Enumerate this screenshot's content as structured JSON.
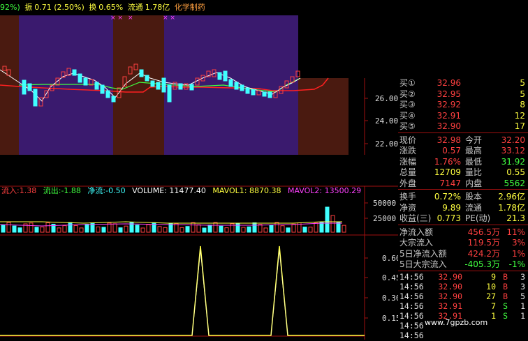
{
  "header": {
    "pct_fragment": "92%)",
    "amplitude_label": "振",
    "amplitude_value": "0.71 (2.50%)",
    "turnover_label": "换",
    "turnover_value": "0.65%",
    "float_label": "流通",
    "float_value": "1.78亿",
    "sector": "化学制药"
  },
  "price_axis": [
    "26.00",
    "24.00",
    "22.00"
  ],
  "volume_header": {
    "inflow_label": "流入:",
    "inflow_value": "1.38",
    "outflow_label": "流出:",
    "outflow_value": "-1.88",
    "net_label": "净流:",
    "net_value": "-0.50",
    "volume_text": "VOLUME: 11477.40",
    "mavol1_text": "MAVOL1: 8870.38",
    "mavol2_text": "MAVOL2: 13500.29"
  },
  "volume_axis": [
    "50000",
    "25000"
  ],
  "indicator_axis": [
    "0.60",
    "0.45",
    "0.30",
    "0.15"
  ],
  "order_book": [
    {
      "label": "买①",
      "price": "32.96",
      "qty": "5"
    },
    {
      "label": "买②",
      "price": "32.95",
      "qty": "5"
    },
    {
      "label": "买③",
      "price": "32.92",
      "qty": "8"
    },
    {
      "label": "买④",
      "price": "32.91",
      "qty": "12"
    },
    {
      "label": "买⑤",
      "price": "32.90",
      "qty": "17"
    }
  ],
  "quote": [
    {
      "l1": "现价",
      "v1": "32.98",
      "l2": "今开",
      "v2": "32.20",
      "c1": "#ff4040",
      "c2": "#ff4040"
    },
    {
      "l1": "涨跌",
      "v1": "0.57",
      "l2": "最高",
      "v2": "33.12",
      "c1": "#ff4040",
      "c2": "#ff4040"
    },
    {
      "l1": "涨幅",
      "v1": "1.76%",
      "l2": "最低",
      "v2": "31.92",
      "c1": "#ff4040",
      "c2": "#40ff40"
    },
    {
      "l1": "总量",
      "v1": "12709",
      "l2": "量比",
      "v2": "0.55",
      "c1": "#ffff40",
      "c2": "#ffff40"
    },
    {
      "l1": "外盘",
      "v1": "7147",
      "l2": "内盘",
      "v2": "5562",
      "c1": "#ff4040",
      "c2": "#40ff40"
    }
  ],
  "stats": [
    {
      "l1": "换手",
      "v1": "0.72%",
      "l2": "股本",
      "v2": "2.96亿"
    },
    {
      "l1": "净资",
      "v1": "9.89",
      "l2": "流通",
      "v2": "1.78亿"
    },
    {
      "l1": "收益(三)",
      "v1": "0.773",
      "l2": "PE(动)",
      "v2": "21.3"
    }
  ],
  "flows": [
    {
      "label": "净流入额",
      "value": "456.5万",
      "pct": "11%",
      "color": "#ff4040"
    },
    {
      "label": "大宗流入",
      "value": "119.5万",
      "pct": "3%",
      "color": "#ff4040"
    },
    {
      "label": "5日净流入额",
      "value": "424.2万",
      "pct": "1%",
      "color": "#ff4040"
    },
    {
      "label": "5日大宗流入",
      "value": "-405.3万",
      "pct": "-1%",
      "color": "#40ff40"
    }
  ],
  "ticks": [
    {
      "time": "14:56",
      "price": "32.90",
      "vol": "9",
      "side": "B",
      "n": "3",
      "pc": "#ff4040",
      "sc": "#ff4040"
    },
    {
      "time": "14:56",
      "price": "32.90",
      "vol": "10",
      "side": "B",
      "n": "3",
      "pc": "#ff4040",
      "sc": "#ff4040"
    },
    {
      "time": "14:56",
      "price": "32.90",
      "vol": "27",
      "side": "B",
      "n": "5",
      "pc": "#ff4040",
      "sc": "#ff4040"
    },
    {
      "time": "14:56",
      "price": "32.91",
      "vol": "7",
      "side": "S",
      "n": "1",
      "pc": "#ff4040",
      "sc": "#40ff40"
    },
    {
      "time": "14:56",
      "price": "32.91",
      "vol": "1",
      "side": "S",
      "n": "1",
      "pc": "#ff4040",
      "sc": "#40ff40"
    },
    {
      "time": "14:56",
      "price": "",
      "vol": "",
      "side": "",
      "n": "",
      "pc": "#ff4040",
      "sc": "#40ff40"
    },
    {
      "time": "14:56",
      "price": "",
      "vol": "",
      "side": "",
      "n": "",
      "pc": "#ff4040",
      "sc": "#40ff40"
    }
  ],
  "watermark": "www.7gpzb.com",
  "colors": {
    "up": "#ff4040",
    "down": "#40ff40",
    "cyan": "#40ffff",
    "yellow": "#ffff40",
    "grid": "#a01010",
    "purple_bg": "#3a1a6e",
    "brown_bg": "#4a1a10"
  }
}
